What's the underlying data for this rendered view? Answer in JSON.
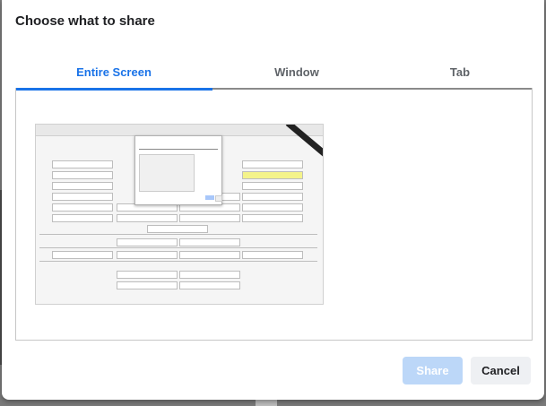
{
  "dialog": {
    "title": "Choose what to share"
  },
  "tabs": [
    {
      "label": "Entire Screen",
      "active": true
    },
    {
      "label": "Window",
      "active": false
    },
    {
      "label": "Tab",
      "active": false
    }
  ],
  "actions": {
    "share_label": "Share",
    "cancel_label": "Cancel"
  },
  "colors": {
    "accent": "#1a73e8",
    "share_disabled_bg": "#bcd7f8",
    "highlight_yellow": "#f4f38a"
  },
  "icons": {
    "screen_preview": "screen-thumbnail-icon"
  }
}
